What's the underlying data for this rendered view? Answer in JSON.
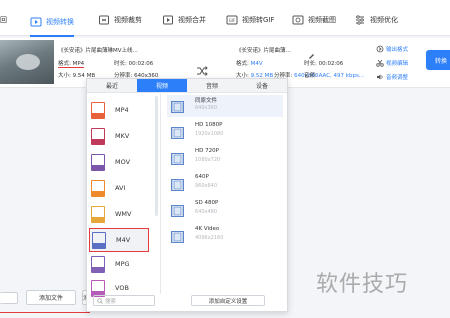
{
  "toolbar": {
    "items": [
      {
        "label": "回",
        "icon": "home-icon"
      },
      {
        "label": "视频转换",
        "icon": "video-convert-icon"
      },
      {
        "label": "视频裁剪",
        "icon": "crop-icon"
      },
      {
        "label": "视频合并",
        "icon": "merge-icon"
      },
      {
        "label": "视频转GIF",
        "icon": "gif-icon"
      },
      {
        "label": "视频截图",
        "icon": "screenshot-icon"
      },
      {
        "label": "视频优化",
        "icon": "optimize-icon"
      }
    ]
  },
  "file": {
    "name": "《长安诺》片尾曲薄琳MV上线...",
    "format_label": "格式: MP4",
    "duration_label": "时长: 00:02:06",
    "size_label": "大小: 9.54 MB",
    "resolution_label": "分辨率: 640x360",
    "output_name": "《长安诺》片尾曲薄...",
    "output_format_label": "格式:",
    "output_format_value": "M4V",
    "output_duration_label": "时长: 00:02:06",
    "output_size_label": "大小:",
    "output_size_value": "9.52 MB",
    "output_resolution_label": "分辨率:",
    "output_resolution_value": "640x360",
    "output_audio_label": "音频:",
    "output_audio_value": "AAC, 497 kbps..."
  },
  "side_actions": [
    {
      "label": "输出格式",
      "icon": "output-icon"
    },
    {
      "label": "视频编辑",
      "icon": "scissors-icon"
    },
    {
      "label": "音频调整",
      "icon": "audio-icon"
    }
  ],
  "convert_button": "转换",
  "popup": {
    "tabs": [
      "最近",
      "视频",
      "音频",
      "设备"
    ],
    "active_tab": 1,
    "formats": [
      {
        "label": "MP4",
        "color": "#e8613a"
      },
      {
        "label": "MKV",
        "color": "#c0395a"
      },
      {
        "label": "MOV",
        "color": "#7c56a8"
      },
      {
        "label": "AVI",
        "color": "#ef8a2c"
      },
      {
        "label": "WMV",
        "color": "#e6a73a"
      },
      {
        "label": "M4V",
        "color": "#5b6fc3"
      },
      {
        "label": "MPG",
        "color": "#7f60b5"
      },
      {
        "label": "VOB",
        "color": "#b55cb8"
      }
    ],
    "selected_format": "M4V",
    "resolutions": [
      {
        "title": "同原文件",
        "sub": "640x360"
      },
      {
        "title": "HD 1080P",
        "sub": "1920x1080"
      },
      {
        "title": "HD 720P",
        "sub": "1080x720"
      },
      {
        "title": "640P",
        "sub": "960x640"
      },
      {
        "title": "SD 480P",
        "sub": "640x480"
      },
      {
        "title": "4K Video",
        "sub": "4096x2160"
      }
    ],
    "search_placeholder": "搜索",
    "custom_button": "添加自定义设置"
  },
  "bottom": {
    "add_file": "添加文件",
    "add_folder": "添"
  },
  "watermark": "软件技巧",
  "colors": {
    "accent": "#2d7ff9",
    "highlight_red": "#e23b3b"
  }
}
